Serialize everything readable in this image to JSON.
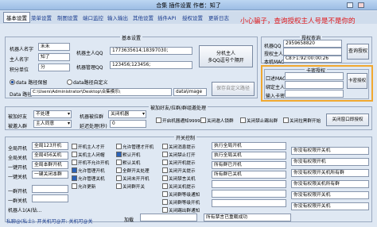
{
  "window": {
    "title": "合集 插件设置 作者：知了"
  },
  "tabs": [
    "基本设置",
    "菜单设置",
    "制图设置",
    "端口监控",
    "输入输出",
    "其他设置",
    "插件API",
    "授权设置",
    "更新日志"
  ],
  "warning": "小心骗子，查询授权主人号是不是你的",
  "basic": {
    "title": "基本设置",
    "robot_name_label": "机器人名字",
    "robot_name": "禾禾",
    "owner_name_label": "主人名字",
    "owner_name": "知了",
    "points_unit_label": "积分单位",
    "points_unit": "分",
    "owner_qq_label": "机器主人QQ",
    "owner_qq": "1773635614;18397030;",
    "admin_qq_label": "机器管理QQ",
    "admin_qq": "123456;123456;",
    "split_owner_button": "分机主人",
    "multi_qq_hint": "多QQ逗号个隔开",
    "data_path_label": "data 路径保留",
    "data_path_custom_label": "data路径自定义",
    "data_path_field_label": "Data 路径",
    "data_path_value": "C:\\Users\\Administrator\\Desktop\\合集模乐\\",
    "data_image_label": "data\\image",
    "save_path_button": "保存自定义路径"
  },
  "auth": {
    "title": "授权查询",
    "robot_qq_label": "机器QQ",
    "robot_qq": "2959658820",
    "owner_label": "授权主人",
    "owner_value": "",
    "mac_label": "本机MAC",
    "mac": "C8:F1:92:00:00:26",
    "query_button": "查询授权",
    "card_title": "卡密授权",
    "mac_field_label": "口述MAC",
    "binding_owner_label": "绑定主人",
    "card_input_label": "输入卡密",
    "card_button": "卡密授权"
  },
  "invite": {
    "title": "被加好友/拉群/群组邀处理",
    "friend_label": "被加好友",
    "friend_value": "不处理",
    "robot_invited_label": "机器被拉群",
    "robot_invited_value": "关闭机器",
    "group_invite_label": "被邀入群",
    "group_invite_value": "主人同意",
    "delay_label": "延迟处理(秒)",
    "delay_value": "0",
    "opt_open_robot": "开启机器通知9999",
    "opt_close_lock": "关闭邀人锁群",
    "opt_no_kick": "关闭禁止踢出群",
    "opt_black": "关闭拉黑群开始",
    "close_notify_button": "关闭窗口即授权"
  },
  "switch": {
    "title": "开关控制",
    "rows": [
      {
        "label": "全局开机",
        "value": "全局123开机"
      },
      {
        "label": "全局关机",
        "value": "全局456关机"
      },
      {
        "label": "一键开机",
        "value": "全局本群开机"
      },
      {
        "label": "一键关机",
        "value": "一键关闭本群"
      },
      {
        "label": "一群开机",
        "value": ""
      },
      {
        "label": "一群关机",
        "value": ""
      }
    ],
    "checks_a": [
      "开机主人才开",
      "关机主人闭帽",
      "开机不允许开机",
      "允许管理开机",
      "允许管理关机",
      "允许更新"
    ],
    "checks_b": [
      "允许管理才开机",
      "默认开机",
      "默认关机",
      "全群开关处理",
      "关闭未开开机",
      "关闭群开关"
    ],
    "checks_c": [
      "关闭消息提示",
      "关闭禁止打开",
      "关闭开机提示",
      "关闭开关提示",
      "关闭禁言关机",
      "关闭关机提示",
      "关闭群等级通知",
      "关闭群等级开机",
      "关闭踢出群通知"
    ],
    "text_a": [
      "执行全局开机",
      "执行全局关机",
      "所有群已开机",
      "所有群已关机",
      "",
      "",
      ""
    ],
    "text_b": [
      "你没有权限开关机",
      "你没有权限开机",
      "你没有权限开关机所有群",
      "你没有权限关机所有群",
      "你没有权限开关机",
      "你没有权限开关机"
    ],
    "footer_left": "机器人1(A)钻...",
    "footer_value": "加载",
    "footer_msg": "所有禁言已重载成功"
  },
  "status_line": "私聊@(私士): 开关机可@开: 关机可@关"
}
